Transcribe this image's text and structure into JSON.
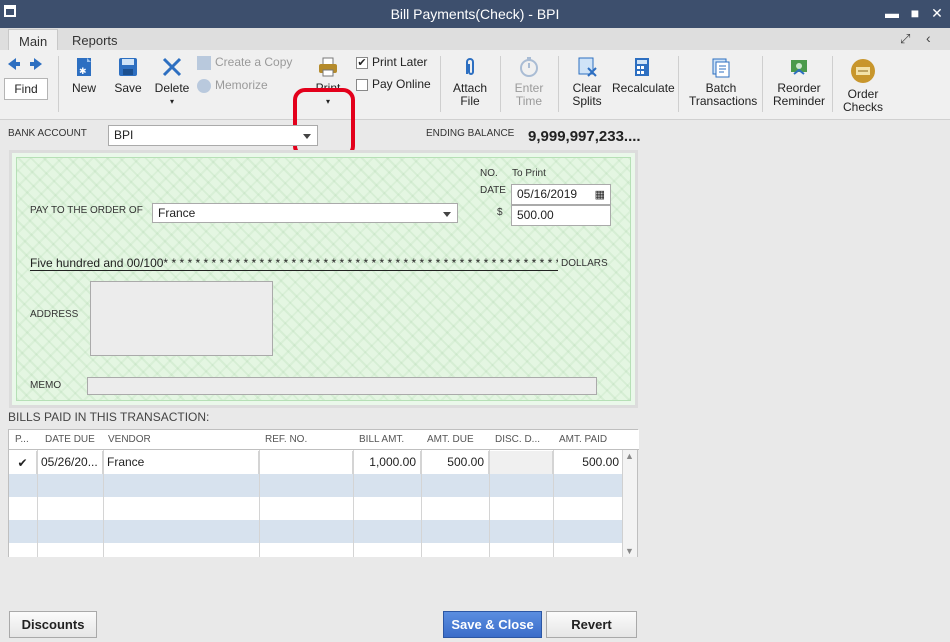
{
  "window": {
    "title": "Bill Payments(Check) - BPI",
    "minimize": "▬",
    "maximize": "■",
    "close": "✕"
  },
  "tabs": [
    {
      "label": "Main",
      "active": true
    },
    {
      "label": "Reports",
      "active": false
    }
  ],
  "toolbar": {
    "find": "Find",
    "new": "New",
    "save": "Save",
    "delete": "Delete",
    "create_copy": "Create a Copy",
    "memorize": "Memorize",
    "print": "Print",
    "print_later": "Print Later",
    "print_later_checked": true,
    "pay_online": "Pay Online",
    "pay_online_checked": false,
    "attach_file_1": "Attach",
    "attach_file_2": "File",
    "enter_time_1": "Enter",
    "enter_time_2": "Time",
    "clear_splits_1": "Clear",
    "clear_splits_2": "Splits",
    "recalculate": "Recalculate",
    "batch_1": "Batch",
    "batch_2": "Transactions",
    "reorder_1": "Reorder",
    "reorder_2": "Reminder",
    "order_checks_1": "Order",
    "order_checks_2": "Checks"
  },
  "account": {
    "label": "BANK ACCOUNT",
    "value": "BPI",
    "ending_balance_label": "ENDING BALANCE",
    "ending_balance": "9,999,997,233...."
  },
  "check": {
    "no_label": "NO.",
    "no_value": "To Print",
    "date_label": "DATE",
    "date_value": "05/16/2019",
    "dollar_label": "$",
    "amount": "500.00",
    "pay_to_label": "PAY TO THE ORDER OF",
    "payee": "France",
    "amount_words": "Five hundred and 00/100* * * * * * * * * * * * * * * * * * * * * * * * * * * * * * * * * * * * * * * * * * * * * * * * * *",
    "dollars_label": "DOLLARS",
    "address_label": "ADDRESS",
    "memo_label": "MEMO",
    "memo_value": ""
  },
  "bills": {
    "section_label": "BILLS PAID IN THIS TRANSACTION:",
    "columns": [
      "P...",
      "DATE DUE",
      "VENDOR",
      "REF. NO.",
      "BILL AMT.",
      "AMT. DUE",
      "DISC. D...",
      "AMT. PAID"
    ],
    "rows": [
      {
        "paid": "✔",
        "date_due": "05/26/20...",
        "vendor": "France",
        "ref_no": "",
        "bill_amt": "1,000.00",
        "amt_due": "500.00",
        "disc_date": "",
        "amt_paid": "500.00"
      }
    ]
  },
  "buttons": {
    "discounts": "Discounts",
    "save_close": "Save & Close",
    "revert": "Revert"
  },
  "colors": {
    "titlebar": "#3d4f6d",
    "check_bg": "#e4f6e2",
    "highlight": "#e3001b",
    "save_close": "#3c73d2"
  }
}
